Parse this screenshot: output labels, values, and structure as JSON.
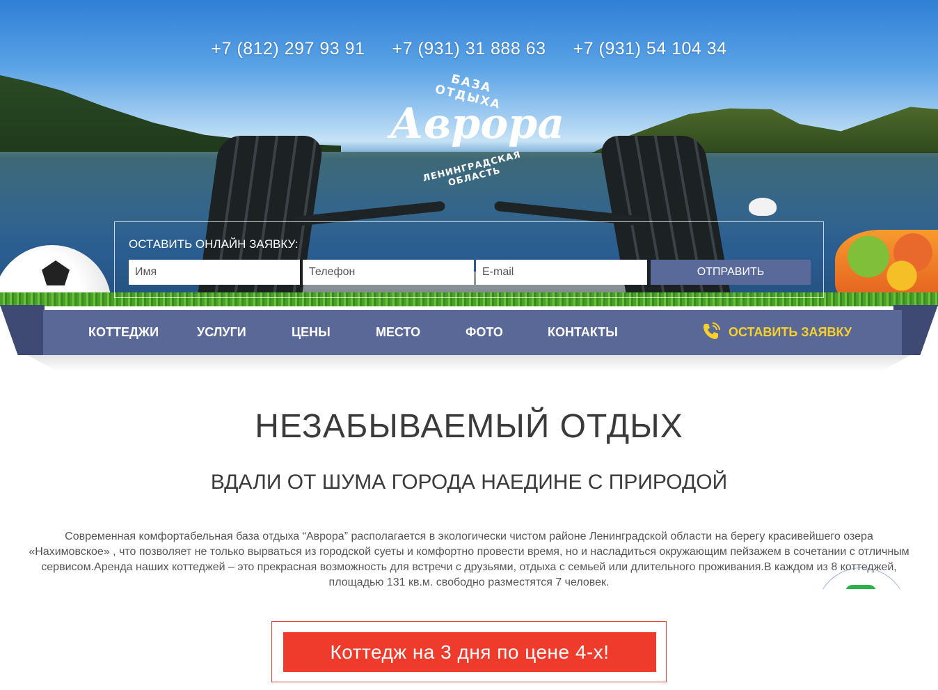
{
  "header": {
    "phones": [
      "+7 (812) 297 93 91",
      "+7 (931) 31 888 63",
      "+7 (931) 54 104 34"
    ],
    "logo": {
      "top_text": "БАЗА ОТДЫХА",
      "name": "Аврора",
      "bottom_text": "ЛЕНИНГРАДСКАЯ ОБЛАСТЬ"
    }
  },
  "form": {
    "title": "ОСТАВИТЬ ОНЛАЙН ЗАЯВКУ:",
    "name_placeholder": "Имя",
    "phone_placeholder": "Телефон",
    "email_placeholder": "E-mail",
    "submit_label": "ОТПРАВИТЬ"
  },
  "nav": {
    "items": [
      "КОТТЕДЖИ",
      "УСЛУГИ",
      "ЦЕНЫ",
      "МЕСТО",
      "ФОТО",
      "КОНТАКТЫ"
    ],
    "cta_label": "ОСТАВИТЬ ЗАЯВКУ",
    "cta_icon": "phone-icon"
  },
  "content": {
    "title": "НЕЗАБЫВАЕМЫЙ ОТДЫХ",
    "subtitle": "ВДАЛИ ОТ ШУМА ГОРОДА НАЕДИНЕ С ПРИРОДОЙ",
    "description": "Современная комфортабельная база отдыха “Аврора” располагается в экологически чистом районе Ленинградской области на берегу красивейшего озера «Нахимовское» , что позволяет не только вырваться из городской суеты и комфортно провести время, но и насладиться окружающим пейзажем в сочетании с отличным сервисом.Аренда наших коттеджей – это прекрасная возможность для встречи с друзьями, отдыха с семьей или длительного проживания.В каждом из 8 коттеджей, площадью 131 кв.м. свободно разместятся 7 человек.",
    "promo_label": "Коттедж на 3 дня по цене 4-х!"
  },
  "colors": {
    "nav_bg": "#5a6898",
    "cta_yellow": "#f7d02c",
    "promo_red": "#ef3b2c",
    "text_dark": "#3a3a3a"
  }
}
